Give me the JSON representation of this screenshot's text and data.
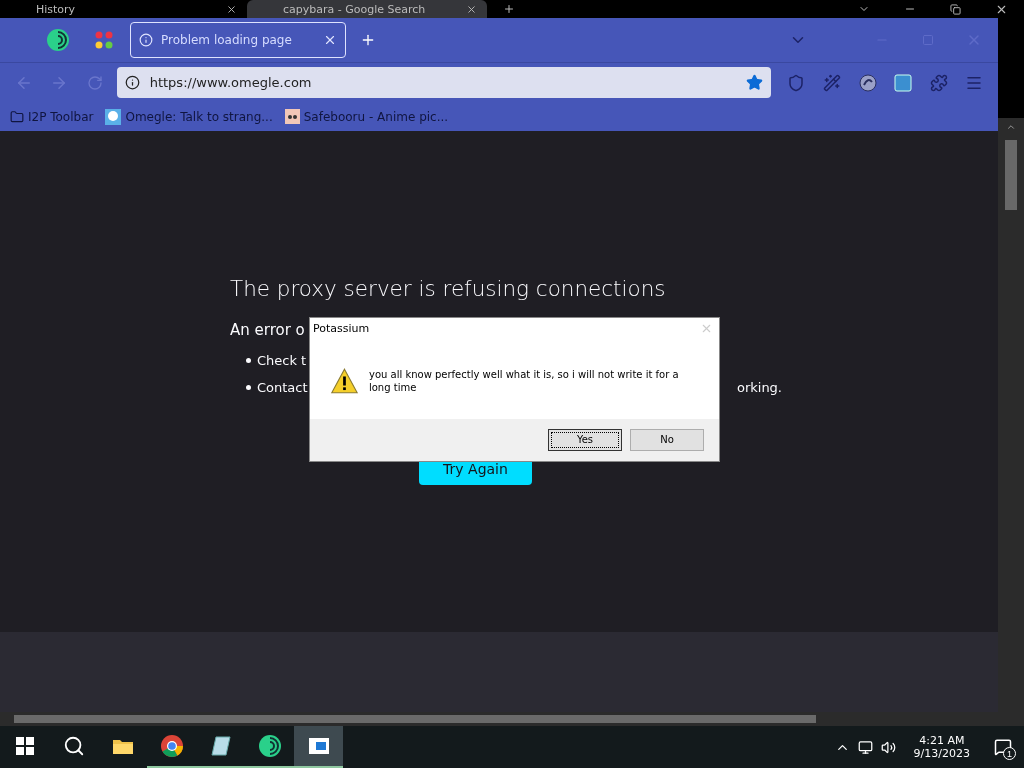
{
  "background_window": {
    "tabs": [
      {
        "title": "History",
        "selected": false
      },
      {
        "title": "capybara - Google Search",
        "selected": true
      }
    ]
  },
  "browser": {
    "tabs": [
      {
        "title": "Problem loading page",
        "selected": true
      }
    ],
    "url": "https://www.omegle.com",
    "bookmarked": true,
    "bookmarks": [
      {
        "label": "I2P Toolbar",
        "kind": "folder"
      },
      {
        "label": "Omegle: Talk to strang...",
        "kind": "chat"
      },
      {
        "label": "Safebooru - Anime pic...",
        "kind": "image"
      }
    ]
  },
  "error_page": {
    "title": "The proxy server is refusing connections",
    "lead": "An error o",
    "bullets": [
      "Check t",
      "Contact"
    ],
    "trailing": "orking.",
    "button": "Try Again"
  },
  "dialog": {
    "title": "Potassium",
    "message": "you all know perfectly well what it is, so i will not write it for a long time",
    "buttons": [
      {
        "label": "Yes",
        "selected": true
      },
      {
        "label": "No",
        "selected": false
      }
    ]
  },
  "taskbar": {
    "apps": [
      {
        "kind": "folder",
        "running": false,
        "selected": false
      },
      {
        "kind": "chrome",
        "running": true,
        "selected": false
      },
      {
        "kind": "notes",
        "running": true,
        "selected": false
      },
      {
        "kind": "tor",
        "running": true,
        "selected": false
      },
      {
        "kind": "window",
        "running": true,
        "selected": true
      }
    ],
    "time": "4:21 AM",
    "date": "9/13/2023",
    "notifications": "1"
  }
}
